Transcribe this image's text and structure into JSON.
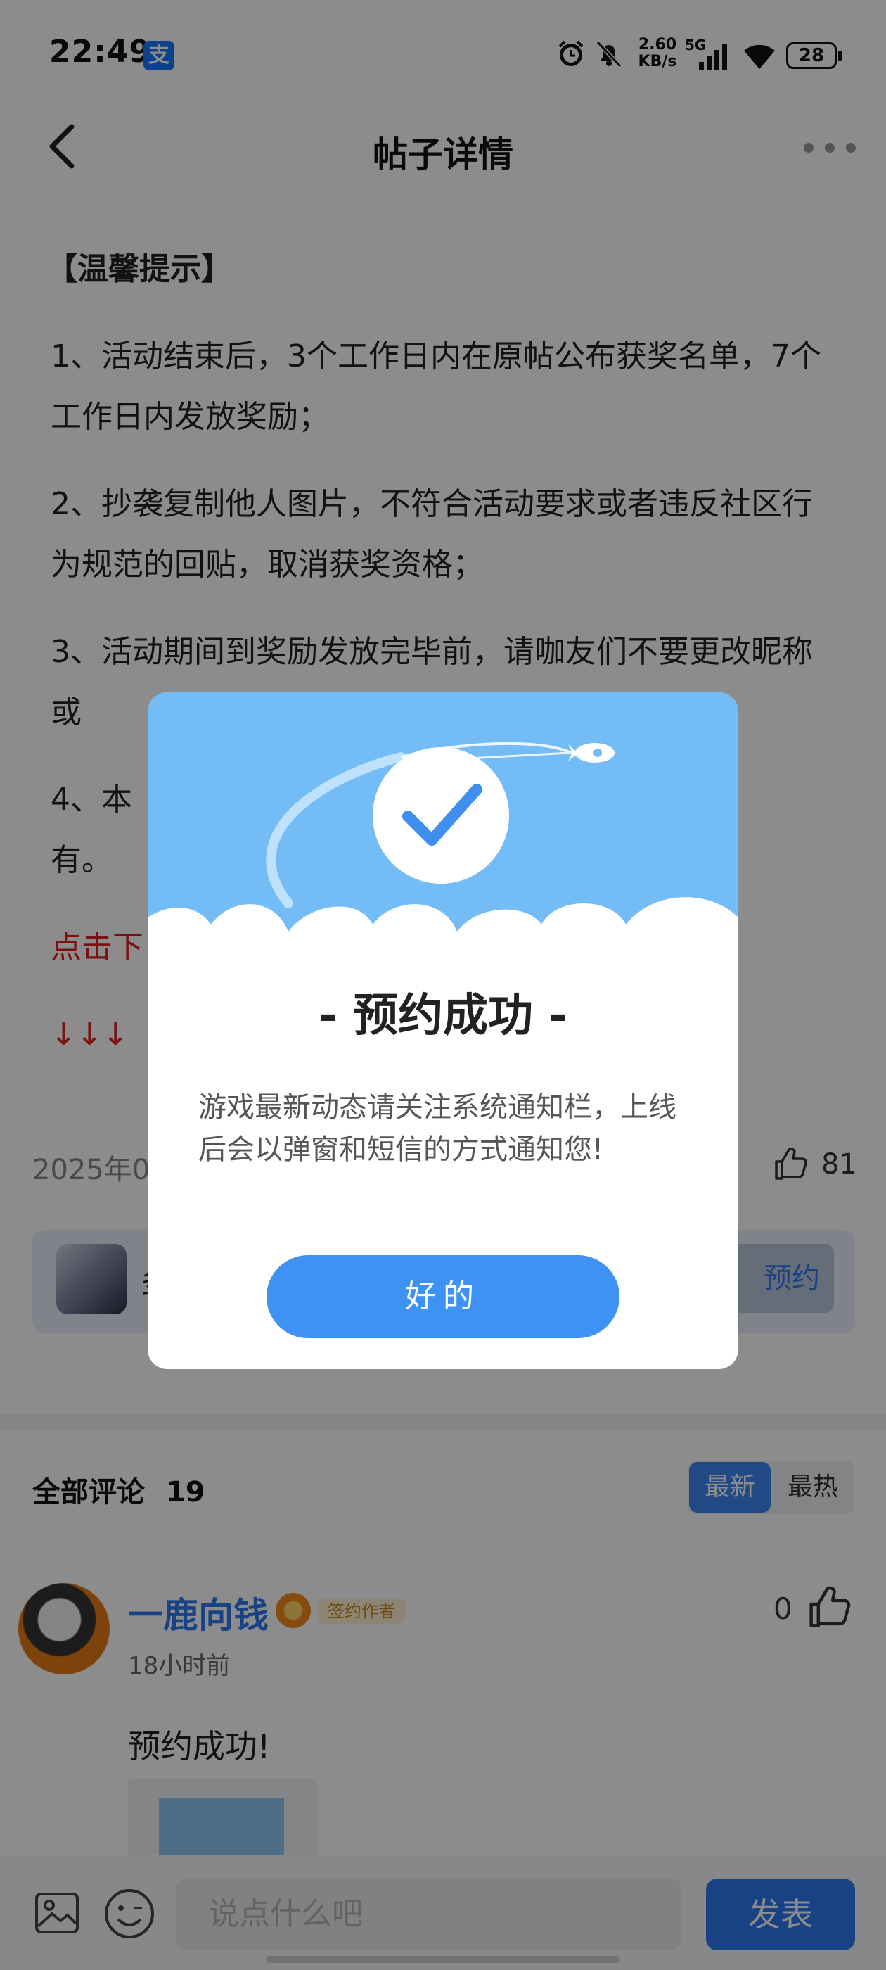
{
  "status_bar": {
    "time": "22:49",
    "app_badge": "支",
    "net_speed_value": "2.60",
    "net_speed_unit": "KB/s",
    "network": "5G",
    "battery": "28"
  },
  "header": {
    "title": "帖子详情"
  },
  "article": {
    "tip_title": "【温馨提示】",
    "items": [
      "1、活动结束后，3个工作日内在原帖公布获奖名单，7个工作日内发放奖励；",
      "2、抄袭复制他人图片，不符合活动要求或者违反社区行为规范的回贴，取消获奖资格；",
      "3、活动期间到奖励发放完毕前，请咖友们不要更改昵称或",
      "4、本",
      "有。"
    ],
    "link_text": "点击下",
    "arrows": "↓↓↓"
  },
  "post_meta": {
    "date": "2025年0",
    "likes": "81"
  },
  "game_card": {
    "name": "多",
    "reserve_label": "预约"
  },
  "comments": {
    "title": "全部评论",
    "count": "19",
    "sort_new": "最新",
    "sort_hot": "最热",
    "items": [
      {
        "user": "一鹿向钱",
        "badge": "签约作者",
        "time": "18小时前",
        "likes": "0",
        "text": "预约成功!"
      }
    ]
  },
  "bottom_bar": {
    "placeholder": "说点什么吧",
    "publish_label": "发表"
  },
  "dialog": {
    "title": "- 预约成功 -",
    "message": "游戏最新动态请关注系统通知栏，上线后会以弹窗和短信的方式通知您!",
    "ok_label": "好的"
  },
  "colors": {
    "brand_blue": "#2f78f0",
    "dialog_sky": "#73bcf6",
    "ok_button": "#3d92f3",
    "link_red": "#e02020"
  }
}
